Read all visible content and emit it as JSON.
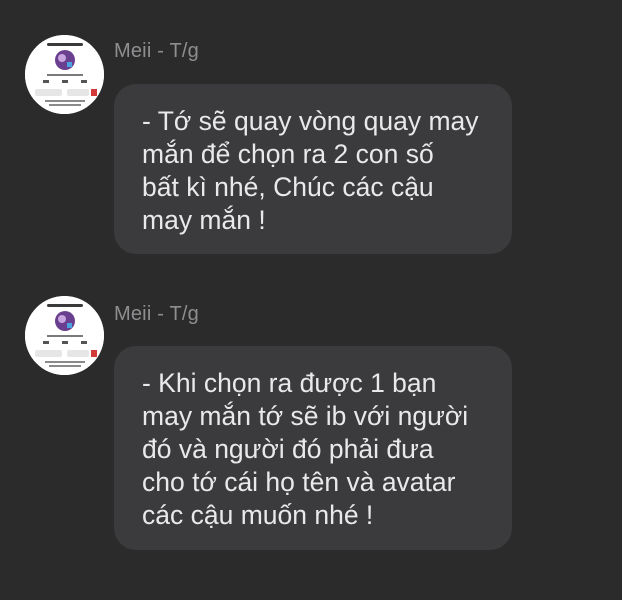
{
  "messages": [
    {
      "sender": "Meii - T/g",
      "lines": [
        "- Tớ sẽ quay vòng quay may",
        "mắn để chọn ra 2 con số",
        "bất kì nhé, Chúc các cậu",
        "may mắn !"
      ]
    },
    {
      "sender": "Meii - T/g",
      "lines": [
        "- Khi chọn ra được 1 bạn",
        "may mắn tớ sẽ ib với người",
        "đó và người đó phải đưa",
        "cho tớ cái họ tên và avatar",
        "các cậu muốn nhé !"
      ]
    }
  ],
  "colors": {
    "background": "#2b2b2c",
    "bubble": "#3b3b3d",
    "sender_text": "#8e8e90",
    "message_text": "#e9e9ea",
    "avatar_bg": "#ffffff",
    "avatar_accent": "#6b3f8f"
  },
  "icons": {
    "avatar": "profile-screenshot-avatar"
  }
}
